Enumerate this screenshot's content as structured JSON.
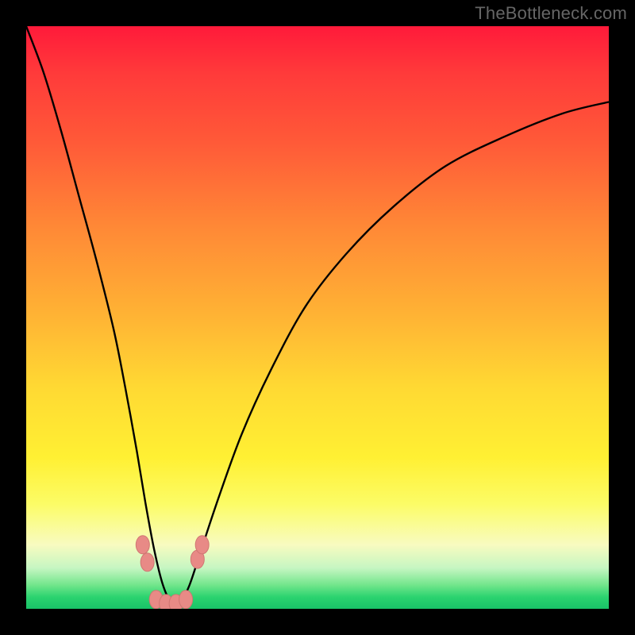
{
  "watermark": "TheBottleneck.com",
  "colors": {
    "frame": "#000000",
    "curve_stroke": "#000000",
    "marker_fill": "#e88a86",
    "marker_stroke": "#d07672"
  },
  "chart_data": {
    "type": "line",
    "title": "",
    "xlabel": "",
    "ylabel": "",
    "xlim": [
      0,
      100
    ],
    "ylim": [
      0,
      100
    ],
    "grid": false,
    "note": "No numeric axis ticks or labels are visible; values are estimated from pixel geometry on a 0–100 normalized scale (origin bottom-left). Curve is a V-shaped bottleneck profile reaching ~0 near x≈25.",
    "series": [
      {
        "name": "bottleneck-curve",
        "x": [
          0,
          3,
          6,
          9,
          12,
          15,
          17,
          19,
          20.5,
          22,
          23.5,
          25,
          26.5,
          28,
          30,
          33,
          37,
          42,
          48,
          55,
          63,
          72,
          82,
          92,
          100
        ],
        "y": [
          100,
          92,
          82,
          71,
          60,
          48,
          38,
          27,
          18,
          10,
          4,
          1,
          1.3,
          4,
          10,
          19,
          30,
          41,
          52,
          61,
          69,
          76,
          81,
          85,
          87
        ]
      }
    ],
    "markers": [
      {
        "x": 20.0,
        "y": 11.0
      },
      {
        "x": 20.8,
        "y": 8.0
      },
      {
        "x": 22.3,
        "y": 1.6
      },
      {
        "x": 24.0,
        "y": 0.9
      },
      {
        "x": 25.7,
        "y": 0.9
      },
      {
        "x": 27.4,
        "y": 1.6
      },
      {
        "x": 29.4,
        "y": 8.5
      },
      {
        "x": 30.2,
        "y": 11.0
      }
    ]
  }
}
